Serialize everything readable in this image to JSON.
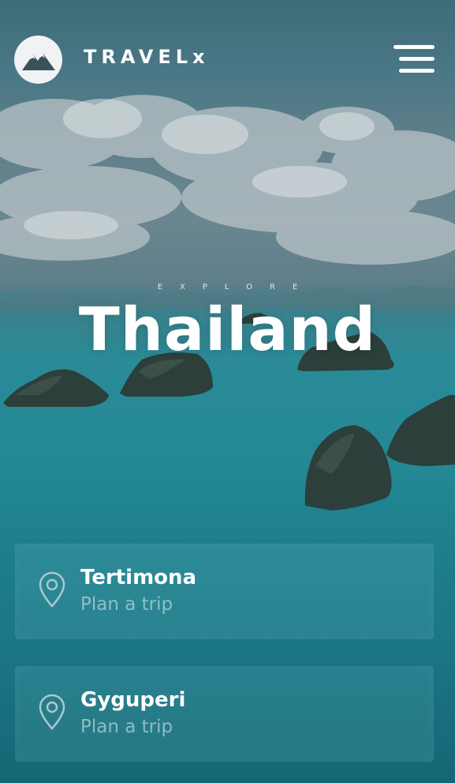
{
  "header": {
    "brand": "TRAVELx",
    "logo_icon": "mountain-logo-icon",
    "menu_icon": "hamburger-menu-icon"
  },
  "hero": {
    "eyebrow": "EXPLORE",
    "title": "Thailand"
  },
  "destinations": [
    {
      "name": "Tertimona",
      "action": "Plan a trip",
      "icon": "location-pin-icon"
    },
    {
      "name": "Gyguperi",
      "action": "Plan a trip",
      "icon": "location-pin-icon"
    }
  ],
  "colors": {
    "water": "#248995",
    "sky": "#4a7886",
    "text": "#ffffff"
  }
}
